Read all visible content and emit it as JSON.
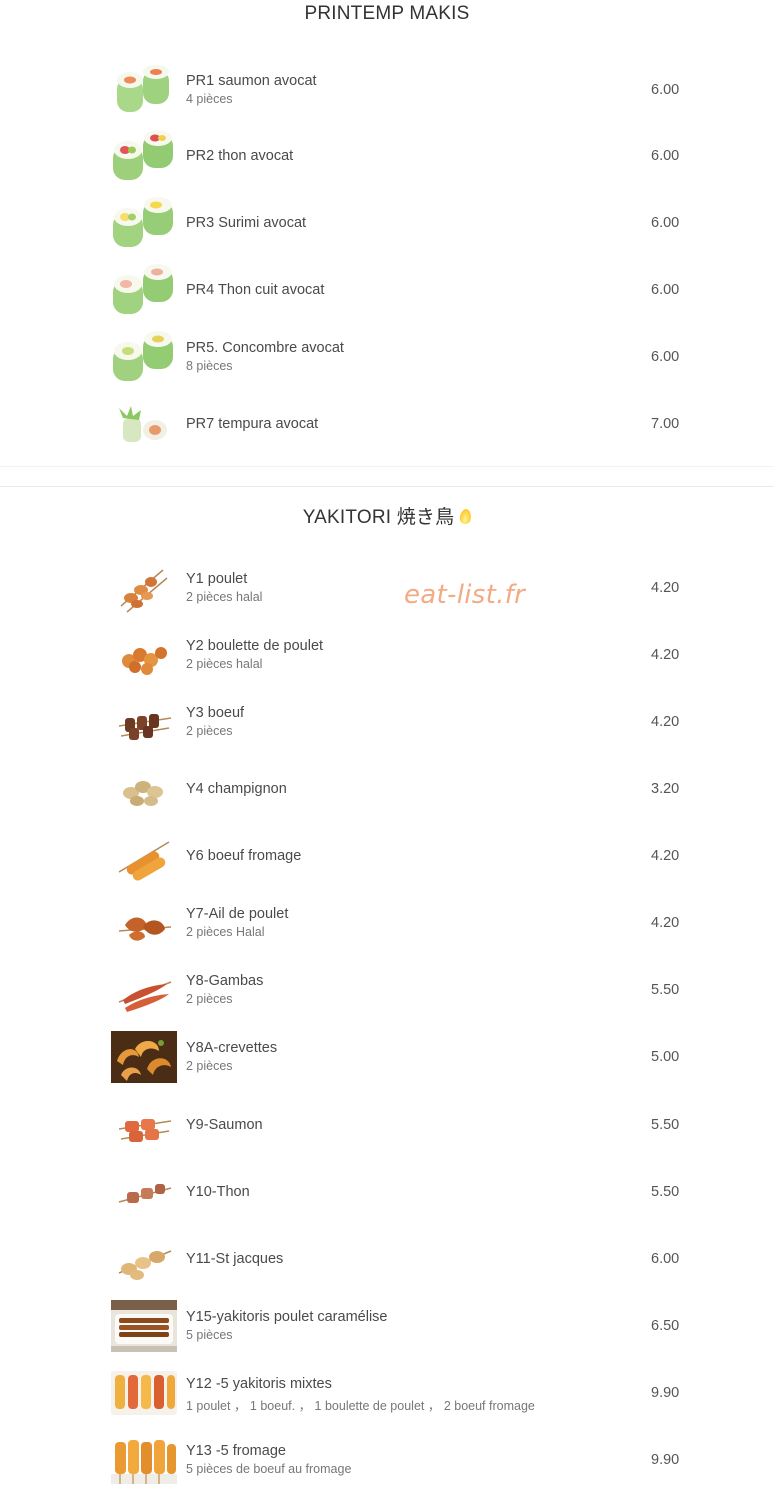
{
  "sections": {
    "makis": {
      "title": "PRINTEMP MAKIS",
      "items": [
        {
          "name": "PR1 saumon avocat",
          "desc": "4 pièces",
          "price": "6.00",
          "image": "spring-roll-salmon-image"
        },
        {
          "name": "PR2 thon avocat",
          "desc": "",
          "price": "6.00",
          "image": "spring-roll-tuna-image"
        },
        {
          "name": "PR3 Surimi avocat",
          "desc": "",
          "price": "6.00",
          "image": "spring-roll-surimi-image"
        },
        {
          "name": "PR4 Thon cuit avocat",
          "desc": "",
          "price": "6.00",
          "image": "spring-roll-cooked-tuna-image"
        },
        {
          "name": "PR5. Concombre avocat",
          "desc": "8 pièces",
          "price": "6.00",
          "image": "spring-roll-cucumber-image"
        },
        {
          "name": "PR7 tempura avocat",
          "desc": "",
          "price": "7.00",
          "image": "spring-roll-tempura-image"
        }
      ]
    },
    "yakitori": {
      "title": "YAKITORI 焼き鳥",
      "title_icon": "flame-icon",
      "items": [
        {
          "name": "Y1 poulet",
          "desc": "2 pièces halal",
          "price": "4.20",
          "image": "chicken-skewer-image"
        },
        {
          "name": "Y2 boulette de poulet",
          "desc": "2 pièces halal",
          "price": "4.20",
          "image": "chicken-meatball-image"
        },
        {
          "name": "Y3 boeuf",
          "desc": "2 pièces",
          "price": "4.20",
          "image": "beef-skewer-image"
        },
        {
          "name": "Y4 champignon",
          "desc": "",
          "price": "3.20",
          "image": "mushroom-skewer-image"
        },
        {
          "name": "Y6 boeuf fromage",
          "desc": "",
          "price": "4.20",
          "image": "beef-cheese-skewer-image"
        },
        {
          "name": "Y7-Ail de poulet",
          "desc": "2 pièces Halal",
          "price": "4.20",
          "image": "chicken-wing-image"
        },
        {
          "name": "Y8-Gambas",
          "desc": "2 pièces",
          "price": "5.50",
          "image": "prawn-skewer-image"
        },
        {
          "name": "Y8A-crevettes",
          "desc": "2 pièces",
          "price": "5.00",
          "image": "shrimp-image"
        },
        {
          "name": "Y9-Saumon",
          "desc": "",
          "price": "5.50",
          "image": "salmon-skewer-image"
        },
        {
          "name": "Y10-Thon",
          "desc": "",
          "price": "5.50",
          "image": "tuna-skewer-image"
        },
        {
          "name": "Y11-St jacques",
          "desc": "",
          "price": "6.00",
          "image": "scallop-skewer-image"
        },
        {
          "name": "Y15-yakitoris poulet caramélise",
          "desc": "5 pièces",
          "price": "6.50",
          "image": "caramel-chicken-plate-image"
        },
        {
          "name": "Y12 -5 yakitoris mixtes",
          "desc": "1 poulet ， 1 boeuf. ， 1 boulette de poulet ， 2 boeuf fromage",
          "price": "9.90",
          "image": "mixed-skewers-image"
        },
        {
          "name": "Y13 -5 fromage",
          "desc": "5 pièces de boeuf au fromage",
          "price": "9.90",
          "image": "cheese-skewers-image"
        }
      ]
    }
  },
  "watermark": "eat-list.fr",
  "colors": {
    "watermark": "#f2ab83",
    "flame": "#f6b614",
    "text": "#4a4a4a",
    "muted": "#777777"
  }
}
